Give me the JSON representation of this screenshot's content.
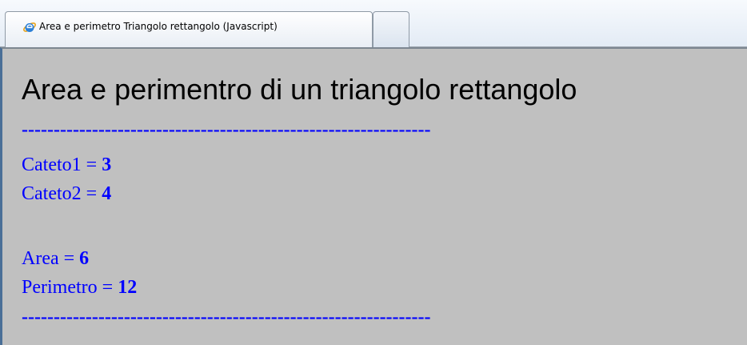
{
  "browser": {
    "tab_title": "Area e perimetro Triangolo rettangolo (Javascript)",
    "tab_icon": "internet-explorer-icon"
  },
  "page": {
    "title": "Area e perimentro di un triangolo rettangolo",
    "separator": "----------------------------------------------------------------",
    "colors": {
      "background": "#c0c0c0",
      "text": "#0000ff",
      "title": "#000000"
    },
    "results": [
      {
        "label": "Cateto1 = ",
        "value": "3"
      },
      {
        "label": "Cateto2 = ",
        "value": "4"
      },
      {
        "label": "Area = ",
        "value": "6"
      },
      {
        "label": "Perimetro = ",
        "value": "12"
      }
    ]
  }
}
